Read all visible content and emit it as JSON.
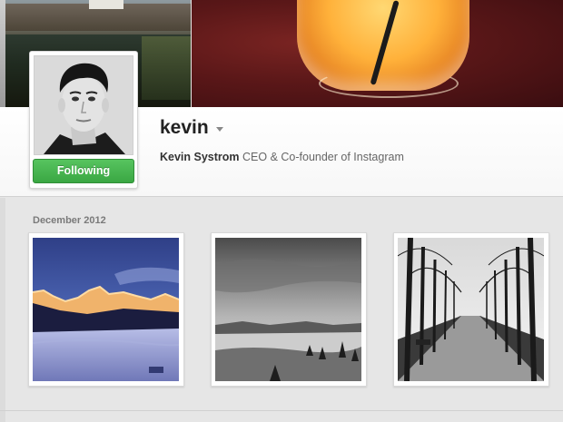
{
  "profile": {
    "username": "kevin",
    "full_name": "Kevin Systrom",
    "bio": " CEO & Co-founder of Instagram",
    "follow_button": "Following"
  },
  "timeline": {
    "month_label": "December 2012",
    "photos": [
      {
        "subject": "snowy mountain sunset"
      },
      {
        "subject": "black and white lake view"
      },
      {
        "subject": "tree lined path"
      }
    ]
  },
  "colors": {
    "follow_green": "#3aa743",
    "page_background": "#e6e6e6"
  },
  "icons": [
    "dropdown-caret-icon"
  ]
}
